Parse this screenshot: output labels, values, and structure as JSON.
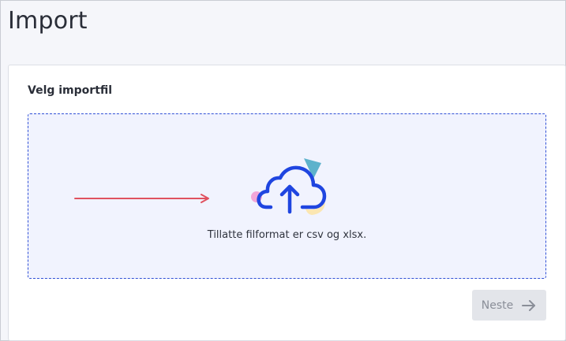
{
  "page": {
    "title": "Import"
  },
  "import_card": {
    "heading": "Velg importfil",
    "dropzone": {
      "hint": "Tillatte filformat er csv og xlsx.",
      "icon": "cloud-upload-icon",
      "pointer": "arrow-right-icon"
    },
    "next_button": {
      "label": "Neste",
      "icon": "arrow-right-icon",
      "disabled": true
    }
  },
  "colors": {
    "accent": "#1f45e0",
    "dropzone_bg": "#f1f3fe",
    "pointer_arrow": "#e0515f",
    "deco_pink": "#f2a6d8",
    "deco_teal": "#5db2cc",
    "deco_yellow": "#fbe6b2",
    "disabled_button_bg": "#e3e5ea"
  }
}
